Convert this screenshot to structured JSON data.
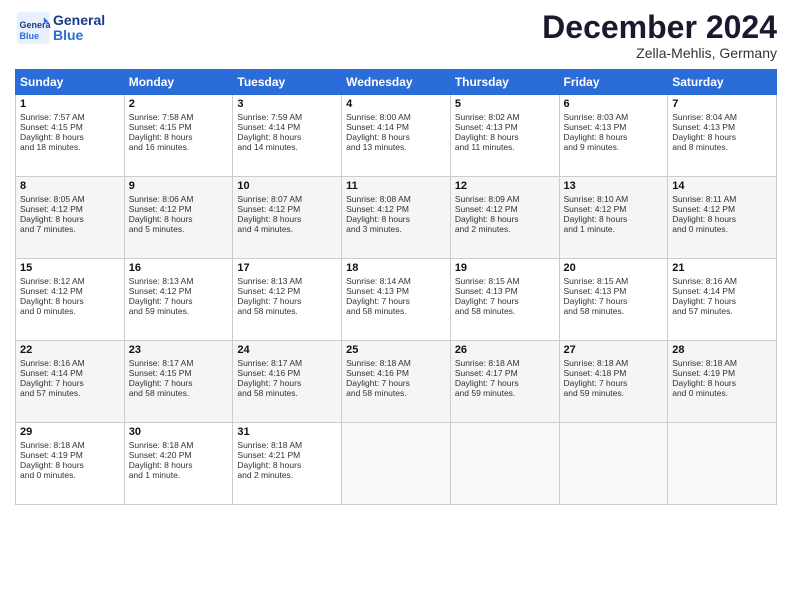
{
  "header": {
    "logo_line1": "General",
    "logo_line2": "Blue",
    "month": "December 2024",
    "location": "Zella-Mehlis, Germany"
  },
  "days_of_week": [
    "Sunday",
    "Monday",
    "Tuesday",
    "Wednesday",
    "Thursday",
    "Friday",
    "Saturday"
  ],
  "weeks": [
    [
      {
        "day": "1",
        "lines": [
          "Sunrise: 7:57 AM",
          "Sunset: 4:15 PM",
          "Daylight: 8 hours",
          "and 18 minutes."
        ]
      },
      {
        "day": "2",
        "lines": [
          "Sunrise: 7:58 AM",
          "Sunset: 4:15 PM",
          "Daylight: 8 hours",
          "and 16 minutes."
        ]
      },
      {
        "day": "3",
        "lines": [
          "Sunrise: 7:59 AM",
          "Sunset: 4:14 PM",
          "Daylight: 8 hours",
          "and 14 minutes."
        ]
      },
      {
        "day": "4",
        "lines": [
          "Sunrise: 8:00 AM",
          "Sunset: 4:14 PM",
          "Daylight: 8 hours",
          "and 13 minutes."
        ]
      },
      {
        "day": "5",
        "lines": [
          "Sunrise: 8:02 AM",
          "Sunset: 4:13 PM",
          "Daylight: 8 hours",
          "and 11 minutes."
        ]
      },
      {
        "day": "6",
        "lines": [
          "Sunrise: 8:03 AM",
          "Sunset: 4:13 PM",
          "Daylight: 8 hours",
          "and 9 minutes."
        ]
      },
      {
        "day": "7",
        "lines": [
          "Sunrise: 8:04 AM",
          "Sunset: 4:13 PM",
          "Daylight: 8 hours",
          "and 8 minutes."
        ]
      }
    ],
    [
      {
        "day": "8",
        "lines": [
          "Sunrise: 8:05 AM",
          "Sunset: 4:12 PM",
          "Daylight: 8 hours",
          "and 7 minutes."
        ]
      },
      {
        "day": "9",
        "lines": [
          "Sunrise: 8:06 AM",
          "Sunset: 4:12 PM",
          "Daylight: 8 hours",
          "and 5 minutes."
        ]
      },
      {
        "day": "10",
        "lines": [
          "Sunrise: 8:07 AM",
          "Sunset: 4:12 PM",
          "Daylight: 8 hours",
          "and 4 minutes."
        ]
      },
      {
        "day": "11",
        "lines": [
          "Sunrise: 8:08 AM",
          "Sunset: 4:12 PM",
          "Daylight: 8 hours",
          "and 3 minutes."
        ]
      },
      {
        "day": "12",
        "lines": [
          "Sunrise: 8:09 AM",
          "Sunset: 4:12 PM",
          "Daylight: 8 hours",
          "and 2 minutes."
        ]
      },
      {
        "day": "13",
        "lines": [
          "Sunrise: 8:10 AM",
          "Sunset: 4:12 PM",
          "Daylight: 8 hours",
          "and 1 minute."
        ]
      },
      {
        "day": "14",
        "lines": [
          "Sunrise: 8:11 AM",
          "Sunset: 4:12 PM",
          "Daylight: 8 hours",
          "and 0 minutes."
        ]
      }
    ],
    [
      {
        "day": "15",
        "lines": [
          "Sunrise: 8:12 AM",
          "Sunset: 4:12 PM",
          "Daylight: 8 hours",
          "and 0 minutes."
        ]
      },
      {
        "day": "16",
        "lines": [
          "Sunrise: 8:13 AM",
          "Sunset: 4:12 PM",
          "Daylight: 7 hours",
          "and 59 minutes."
        ]
      },
      {
        "day": "17",
        "lines": [
          "Sunrise: 8:13 AM",
          "Sunset: 4:12 PM",
          "Daylight: 7 hours",
          "and 58 minutes."
        ]
      },
      {
        "day": "18",
        "lines": [
          "Sunrise: 8:14 AM",
          "Sunset: 4:13 PM",
          "Daylight: 7 hours",
          "and 58 minutes."
        ]
      },
      {
        "day": "19",
        "lines": [
          "Sunrise: 8:15 AM",
          "Sunset: 4:13 PM",
          "Daylight: 7 hours",
          "and 58 minutes."
        ]
      },
      {
        "day": "20",
        "lines": [
          "Sunrise: 8:15 AM",
          "Sunset: 4:13 PM",
          "Daylight: 7 hours",
          "and 58 minutes."
        ]
      },
      {
        "day": "21",
        "lines": [
          "Sunrise: 8:16 AM",
          "Sunset: 4:14 PM",
          "Daylight: 7 hours",
          "and 57 minutes."
        ]
      }
    ],
    [
      {
        "day": "22",
        "lines": [
          "Sunrise: 8:16 AM",
          "Sunset: 4:14 PM",
          "Daylight: 7 hours",
          "and 57 minutes."
        ]
      },
      {
        "day": "23",
        "lines": [
          "Sunrise: 8:17 AM",
          "Sunset: 4:15 PM",
          "Daylight: 7 hours",
          "and 58 minutes."
        ]
      },
      {
        "day": "24",
        "lines": [
          "Sunrise: 8:17 AM",
          "Sunset: 4:16 PM",
          "Daylight: 7 hours",
          "and 58 minutes."
        ]
      },
      {
        "day": "25",
        "lines": [
          "Sunrise: 8:18 AM",
          "Sunset: 4:16 PM",
          "Daylight: 7 hours",
          "and 58 minutes."
        ]
      },
      {
        "day": "26",
        "lines": [
          "Sunrise: 8:18 AM",
          "Sunset: 4:17 PM",
          "Daylight: 7 hours",
          "and 59 minutes."
        ]
      },
      {
        "day": "27",
        "lines": [
          "Sunrise: 8:18 AM",
          "Sunset: 4:18 PM",
          "Daylight: 7 hours",
          "and 59 minutes."
        ]
      },
      {
        "day": "28",
        "lines": [
          "Sunrise: 8:18 AM",
          "Sunset: 4:19 PM",
          "Daylight: 8 hours",
          "and 0 minutes."
        ]
      }
    ],
    [
      {
        "day": "29",
        "lines": [
          "Sunrise: 8:18 AM",
          "Sunset: 4:19 PM",
          "Daylight: 8 hours",
          "and 0 minutes."
        ]
      },
      {
        "day": "30",
        "lines": [
          "Sunrise: 8:18 AM",
          "Sunset: 4:20 PM",
          "Daylight: 8 hours",
          "and 1 minute."
        ]
      },
      {
        "day": "31",
        "lines": [
          "Sunrise: 8:18 AM",
          "Sunset: 4:21 PM",
          "Daylight: 8 hours",
          "and 2 minutes."
        ]
      },
      null,
      null,
      null,
      null
    ]
  ]
}
